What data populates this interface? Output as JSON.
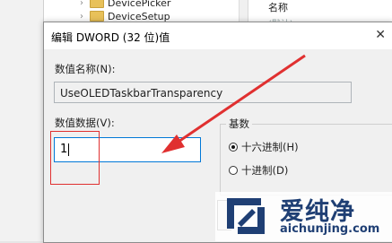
{
  "background_window": {
    "tree_items": [
      "DevicePicker",
      "DeviceSetup"
    ],
    "right_header": "名称",
    "right_faded_text": "(默认)"
  },
  "dialog": {
    "title": "编辑 DWORD (32 位)值",
    "close_glyph": "✕",
    "value_name_label": "数值名称(N):",
    "value_name": "UseOLEDTaskbarTransparency",
    "value_data_label": "数值数据(V):",
    "value_data": "1",
    "base_group_label": "基数",
    "base_options": [
      {
        "label": "十六进制(H)",
        "selected": true
      },
      {
        "label": "十进制(D)",
        "selected": false
      }
    ]
  },
  "annotation": {
    "color": "#e03030"
  },
  "watermark": {
    "name": "爱纯净",
    "url": "aichunjing.com",
    "color": "#1f3f74"
  }
}
